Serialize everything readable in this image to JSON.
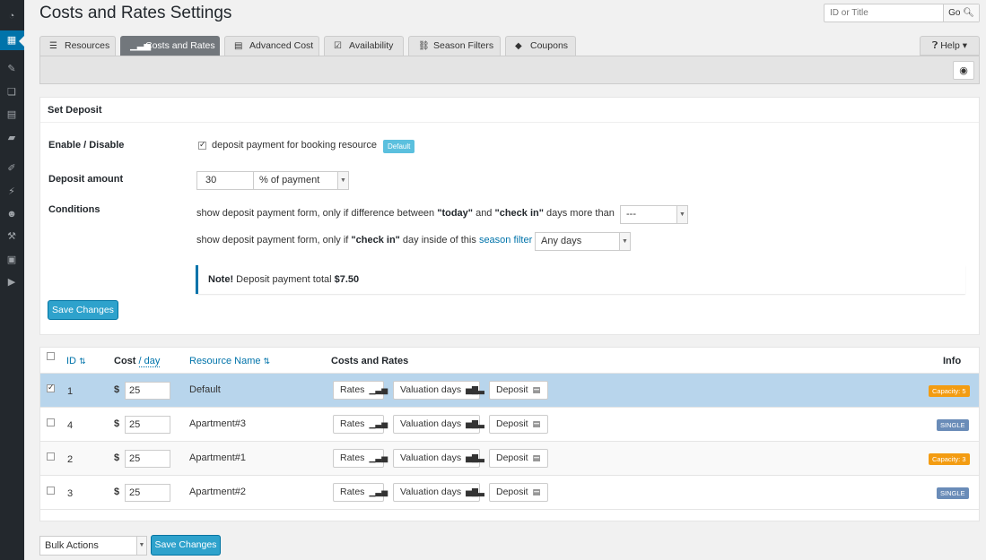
{
  "page": {
    "title": "Costs and Rates Settings"
  },
  "search": {
    "placeholder": "ID or Title",
    "go_label": "Go"
  },
  "tabs": [
    {
      "label": "Resources",
      "icon": "list-icon"
    },
    {
      "label": "Costs and Rates",
      "icon": "bar-chart-icon",
      "active": true
    },
    {
      "label": "Advanced Cost",
      "icon": "list-alt-icon"
    },
    {
      "label": "Availability",
      "icon": "check-square-icon"
    },
    {
      "label": "Season Filters",
      "icon": "link-icon"
    },
    {
      "label": "Coupons",
      "icon": "tag-icon"
    }
  ],
  "help": {
    "label": "Help"
  },
  "deposit": {
    "header": "Set Deposit",
    "enable_label": "Enable / Disable",
    "enable_checked": true,
    "enable_text": "deposit payment for booking resource",
    "enable_badge": "Default",
    "amount_label": "Deposit amount",
    "amount_value": "30",
    "amount_unit": "% of payment",
    "conditions_label": "Conditions",
    "cond1_prefix": "show deposit payment form, only if difference between ",
    "cond1_today": "\"today\"",
    "cond1_and": " and ",
    "cond1_checkin": "\"check in\"",
    "cond1_suffix": " days more than",
    "cond1_select": "---",
    "cond2_prefix": "show deposit payment form, only if ",
    "cond2_checkin": "\"check in\"",
    "cond2_middle": " day inside of this ",
    "cond2_link": "season filter",
    "cond2_select": "Any days",
    "note_bold": "Note!",
    "note_text": " Deposit payment total ",
    "note_amount": "$7.50",
    "save_label": "Save Changes"
  },
  "table": {
    "headers": {
      "id": "ID",
      "cost": "Cost",
      "cost_unit": "/ day",
      "resource": "Resource Name",
      "costs": "Costs and Rates",
      "info": "Info"
    },
    "rows": [
      {
        "id": "1",
        "currency": "$",
        "cost": "25",
        "name": "Default",
        "checked": true,
        "info": "Capacity:  5",
        "info_type": "orange"
      },
      {
        "id": "4",
        "currency": "$",
        "cost": "25",
        "name": "Apartment#3",
        "checked": false,
        "info": "SINGLE",
        "info_type": "gray"
      },
      {
        "id": "2",
        "currency": "$",
        "cost": "25",
        "name": "Apartment#1",
        "checked": false,
        "info": "Capacity:  3",
        "info_type": "orange"
      },
      {
        "id": "3",
        "currency": "$",
        "cost": "25",
        "name": "Apartment#2",
        "checked": false,
        "info": "SINGLE",
        "info_type": "gray"
      }
    ],
    "buttons": {
      "rates": "Rates",
      "valuation": "Valuation days",
      "deposit": "Deposit"
    }
  },
  "footer": {
    "bulk_label": "Bulk Actions",
    "save_label": "Save Changes"
  },
  "colors": {
    "accent": "#0073aa",
    "primary_button": "#2ea2cc",
    "selected_row": "#b8d5ec",
    "badge_orange": "#f39c12",
    "badge_gray": "#6a8cb8",
    "badge_default": "#5bc0de"
  }
}
